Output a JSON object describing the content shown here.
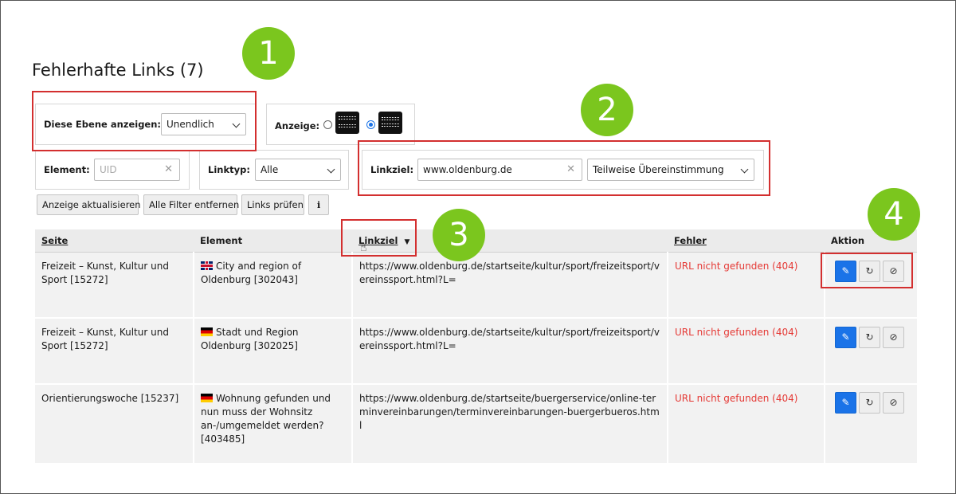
{
  "page": {
    "title": "Fehlerhafte Links (7)"
  },
  "filters": {
    "level_label": "Diese Ebene anzeigen:",
    "level_value": "Unendlich",
    "display_label": "Anzeige:",
    "element_label": "Element:",
    "element_placeholder": "UID",
    "linktype_label": "Linktyp:",
    "linktype_value": "Alle",
    "linktarget_label": "Linkziel:",
    "linktarget_value": "www.oldenburg.de",
    "match_value": "Teilweise Übereinstimmung"
  },
  "buttons": {
    "refresh": "Anzeige aktualisieren",
    "remove_filters": "Alle Filter entfernen",
    "check_links": "Links prüfen",
    "info": "i"
  },
  "table": {
    "headers": {
      "page": "Seite",
      "element": "Element",
      "target": "Linkziel",
      "error": "Fehler",
      "action": "Aktion"
    },
    "rows": [
      {
        "page": "Freizeit – Kunst, Kultur und Sport [15272]",
        "flag": "en",
        "element": "City and region of Oldenburg [302043]",
        "target": "https://www.oldenburg.de/startseite/kultur/sport/freizeitsport/vereinssport.html?L=",
        "error": "URL nicht gefunden (404)"
      },
      {
        "page": "Freizeit – Kunst, Kultur und Sport [15272]",
        "flag": "de",
        "element": "Stadt und Region Oldenburg [302025]",
        "target": "https://www.oldenburg.de/startseite/kultur/sport/freizeitsport/vereinssport.html?L=",
        "error": "URL nicht gefunden (404)"
      },
      {
        "page": "Orientierungswoche [15237]",
        "flag": "de",
        "element": "Wohnung gefunden und nun muss der Wohnsitz an-/umgemeldet werden? [403485]",
        "target": "https://www.oldenburg.de/startseite/buergerservice/online-terminvereinbarungen/terminvereinbarungen-buergerbueros.html",
        "error": "URL nicht gefunden (404)"
      }
    ]
  },
  "callouts": [
    "1",
    "2",
    "3",
    "4"
  ],
  "colors": {
    "accent": "#1a73e8",
    "error": "#e53935",
    "callout": "#7bc61e",
    "highlight": "#d32f2f"
  }
}
